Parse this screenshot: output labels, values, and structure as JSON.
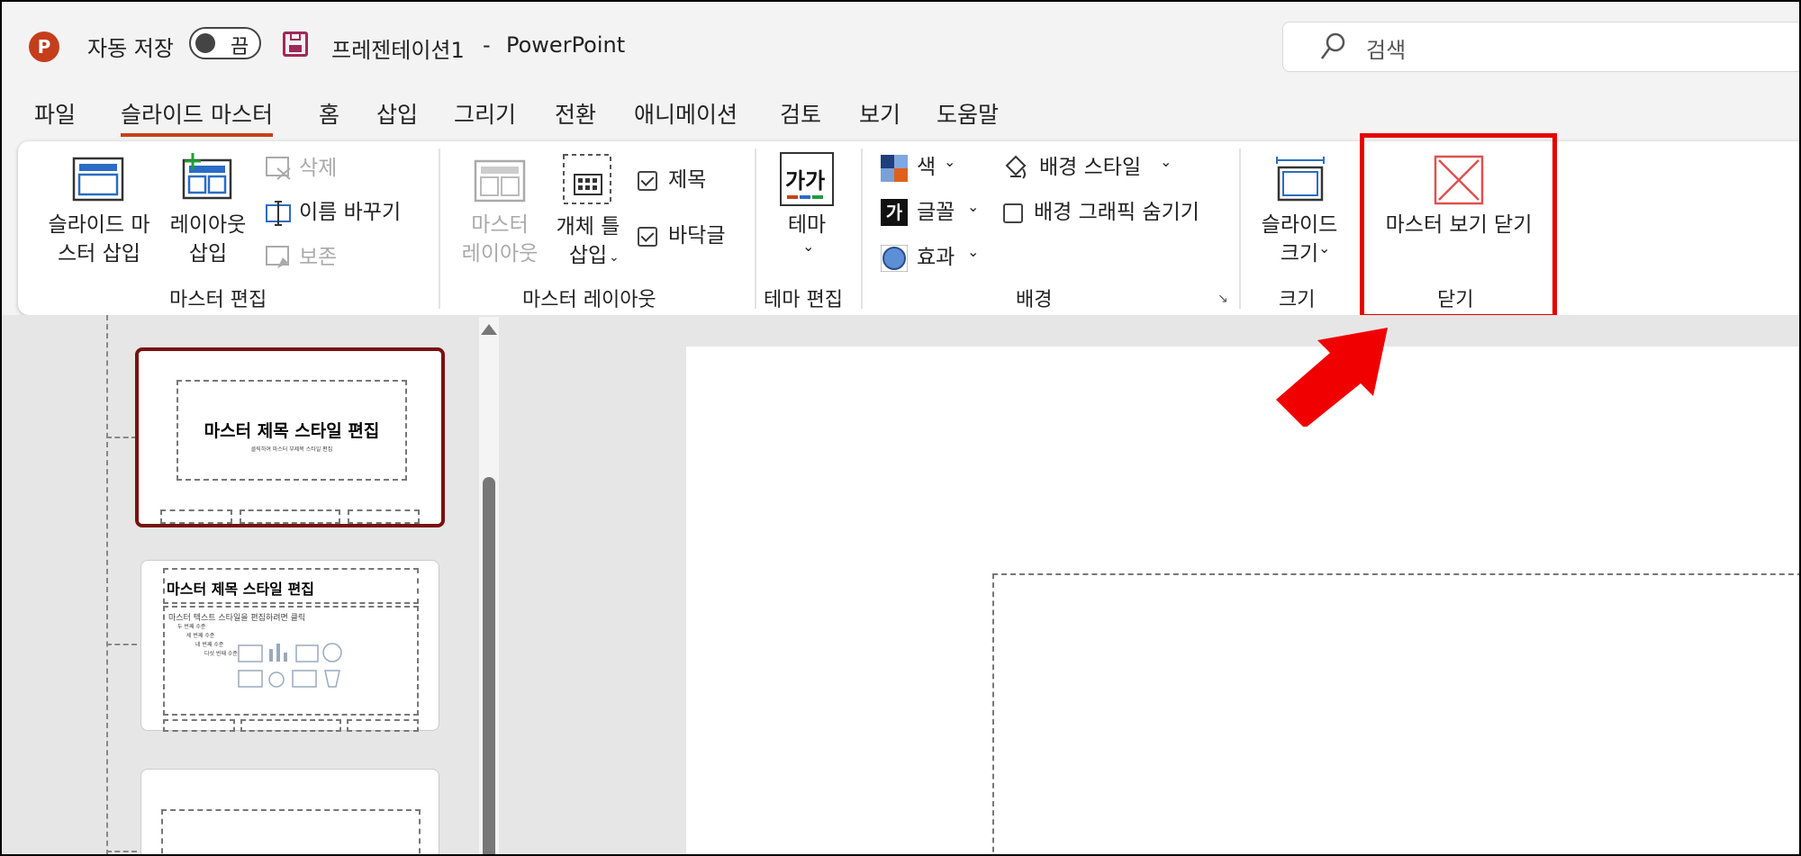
{
  "titlebar": {
    "autosave_label": "자동 저장",
    "autosave_state": "끔",
    "file_name": "프레젠테이션1",
    "separator": "-",
    "app_name": "PowerPoint",
    "search_placeholder": "검색"
  },
  "menu_tabs": [
    "파일",
    "슬라이드 마스터",
    "홈",
    "삽입",
    "그리기",
    "전환",
    "애니메이션",
    "검토",
    "보기",
    "도움말"
  ],
  "ribbon": {
    "master_edit": {
      "insert_master_l1": "슬라이드 마",
      "insert_master_l2": "스터 삽입",
      "insert_layout_l1": "레이아웃",
      "insert_layout_l2": "삽입",
      "delete": "삭제",
      "rename": "이름 바꾸기",
      "preserve": "보존",
      "group": "마스터 편집"
    },
    "master_layout": {
      "master_layout_l1": "마스터",
      "master_layout_l2": "레이아웃",
      "insert_placeholder_l1": "개체 틀",
      "insert_placeholder_l2": "삽입",
      "title_check": "제목",
      "footer_check": "바닥글",
      "group": "마스터 레이아웃"
    },
    "theme_edit": {
      "theme_icon_text": "가가",
      "theme": "테마",
      "group": "테마 편집"
    },
    "background": {
      "colors": "색",
      "fonts_icon_text": "가",
      "fonts": "글꼴",
      "effects": "효과",
      "bg_styles": "배경 스타일",
      "hide_bg": "배경 그래픽 숨기기",
      "group": "배경"
    },
    "size": {
      "slide_size_l1": "슬라이드",
      "slide_size_l2": "크기",
      "group": "크기"
    },
    "close": {
      "close_master": "마스터 보기 닫기",
      "group": "닫기"
    }
  },
  "thumbnails": {
    "t1_title": "마스터 제목 스타일 편집",
    "t1_subtitle": "클릭하여 마스터 부제목 스타일 편집",
    "t2_title": "마스터 제목 스타일 편집",
    "t2_lines": [
      "마스터 텍스트 스타일을 편집하려면 클릭",
      "두 번째 수준",
      "세 번째 수준",
      "네 번째 수준",
      "다섯 번째 수준"
    ]
  },
  "colors": {
    "accent_tab": "#c4421a",
    "highlight": "#e60000",
    "selected_thumb": "#7a1010",
    "ppt_logo": "#c43e1c"
  }
}
